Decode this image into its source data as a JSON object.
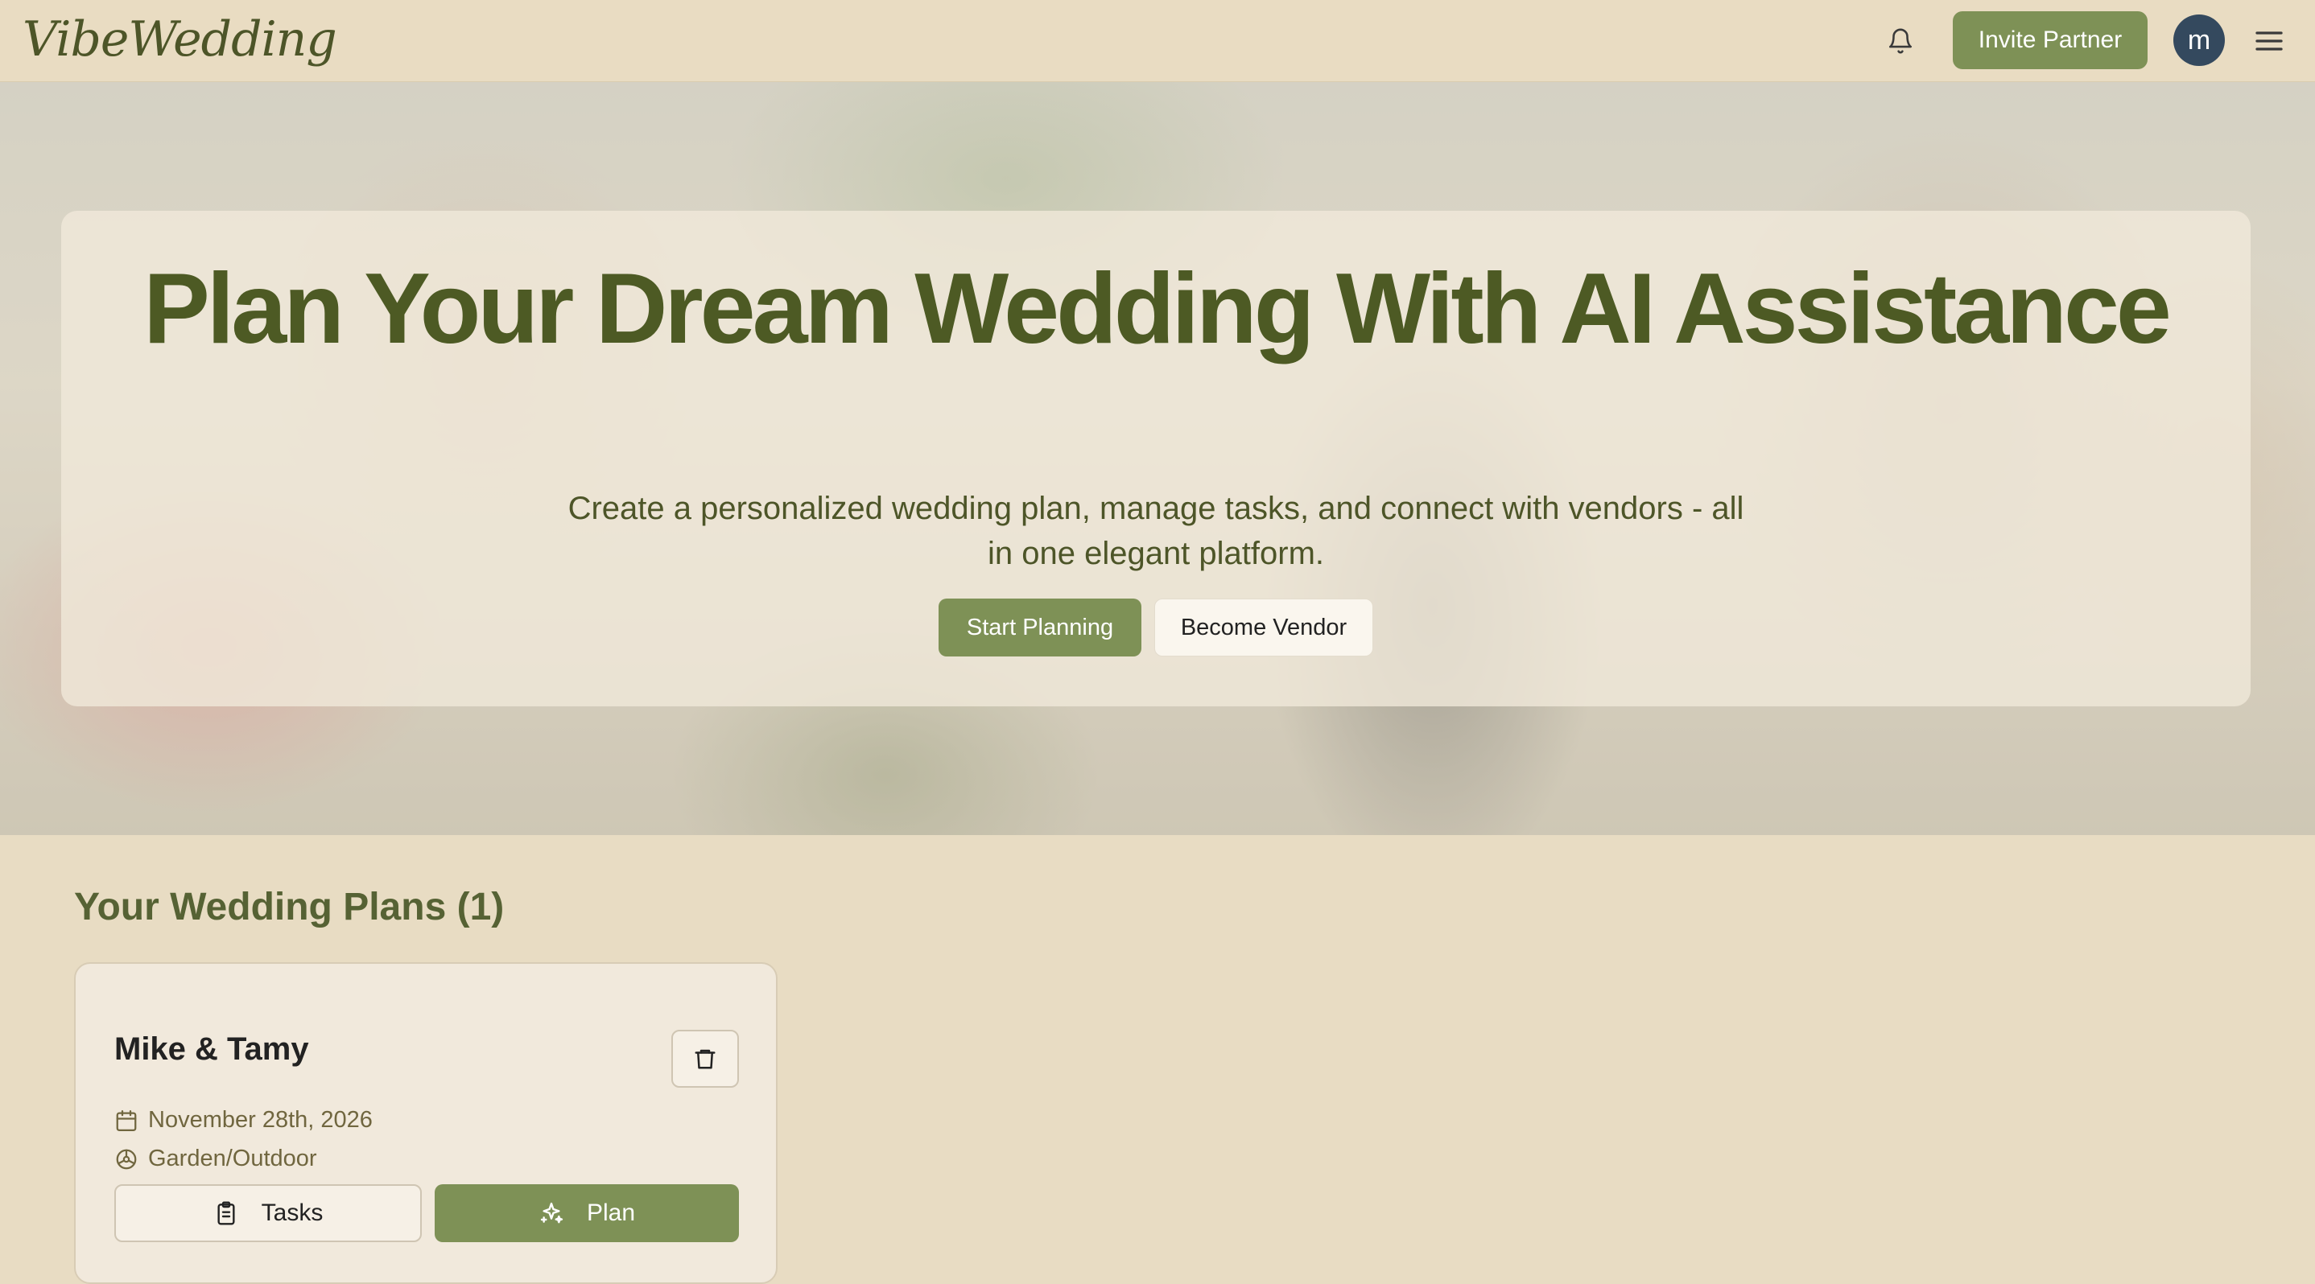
{
  "header": {
    "logo": "VibeWedding",
    "invite_label": "Invite Partner",
    "avatar_initial": "m",
    "icons": [
      "bell-icon",
      "menu-icon"
    ]
  },
  "hero": {
    "title": "Plan Your Dream Wedding With AI Assistance",
    "subtitle": "Create a personalized wedding plan, manage tasks, and connect with vendors - all in one elegant platform.",
    "start_label": "Start Planning",
    "vendor_label": "Become Vendor"
  },
  "plans": {
    "heading": "Your Wedding Plans (1)",
    "items": [
      {
        "names": "Mike & Tamy",
        "date": "November 28th, 2026",
        "venue": "Garden/Outdoor",
        "tasks_label": "Tasks",
        "plan_label": "Plan"
      }
    ]
  },
  "colors": {
    "accent": "#7e9156",
    "heading": "#4d5a24",
    "background": "#e8dcc3",
    "avatar": "#34495e"
  }
}
